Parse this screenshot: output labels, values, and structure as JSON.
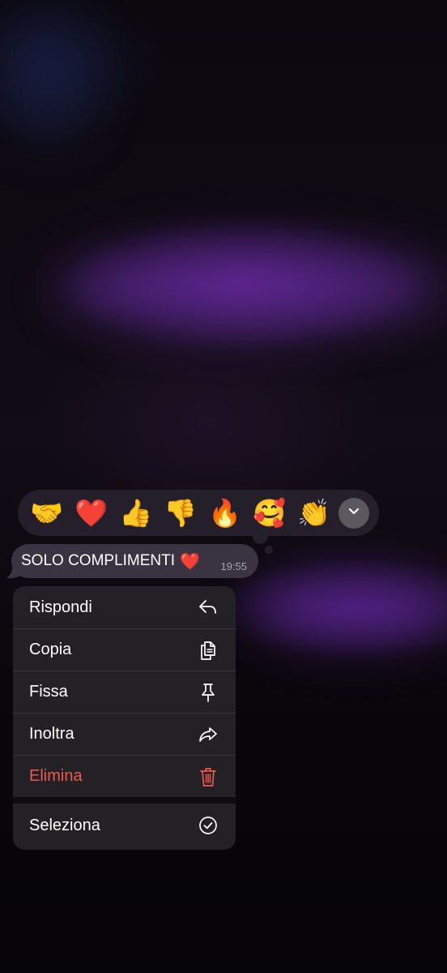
{
  "reactions": [
    {
      "emoji": "🤝",
      "name": "handshake"
    },
    {
      "emoji": "❤️",
      "name": "red-heart"
    },
    {
      "emoji": "👍",
      "name": "thumbs-up"
    },
    {
      "emoji": "👎",
      "name": "thumbs-down"
    },
    {
      "emoji": "🔥",
      "name": "fire"
    },
    {
      "emoji": "🥰",
      "name": "smiling-face-with-hearts"
    },
    {
      "emoji": "👏",
      "name": "clapping-hands"
    }
  ],
  "reaction_bar": {
    "expand_icon": "chevron-down-icon"
  },
  "message": {
    "text": "SOLO COMPLIMENTI",
    "emoji": "❤️",
    "time": "19:55"
  },
  "menu": {
    "items": [
      {
        "label": "Rispondi",
        "icon": "reply-icon"
      },
      {
        "label": "Copia",
        "icon": "copy-icon"
      },
      {
        "label": "Fissa",
        "icon": "pin-icon"
      },
      {
        "label": "Inoltra",
        "icon": "forward-icon"
      },
      {
        "label": "Elimina",
        "icon": "trash-icon",
        "color": "#ec5a4f"
      }
    ],
    "select": {
      "label": "Seleziona",
      "icon": "checkmark-circle-icon"
    }
  },
  "colors": {
    "danger": "#ec5a4f",
    "bubble": "#3a3342",
    "menu_background": "#242226",
    "reaction_bar_background": "#26222c"
  }
}
